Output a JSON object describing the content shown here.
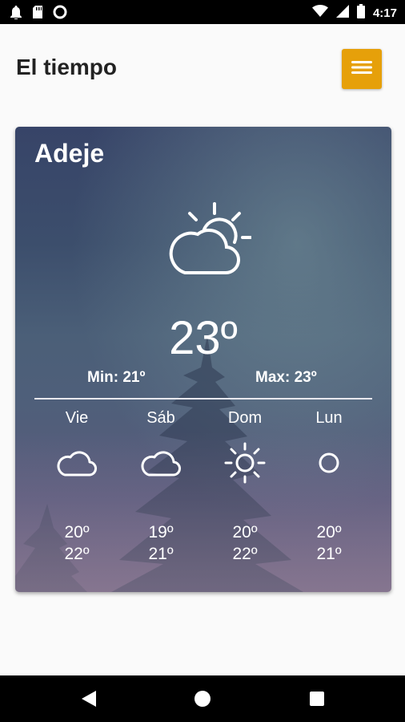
{
  "status_bar": {
    "time": "4:17",
    "icons": [
      "notification-bell-icon",
      "sd-card-icon",
      "circle-o-icon",
      "wifi-icon",
      "signal-icon",
      "battery-icon"
    ]
  },
  "app_bar": {
    "title": "El tiempo",
    "menu_icon": "hamburger-menu-icon",
    "accent": "#e6a00a"
  },
  "weather": {
    "city": "Adeje",
    "current_icon": "partly-sunny-cloud-icon",
    "temperature": "23º",
    "min": "Min: 21º",
    "max": "Max: 23º",
    "forecast": [
      {
        "day": "Vie",
        "icon": "cloud-icon",
        "low": "20º",
        "high": "22º"
      },
      {
        "day": "Sáb",
        "icon": "cloud-icon",
        "low": "19º",
        "high": "21º"
      },
      {
        "day": "Dom",
        "icon": "sun-icon",
        "low": "20º",
        "high": "22º"
      },
      {
        "day": "Lun",
        "icon": "circle-icon",
        "low": "20º",
        "high": "21º"
      }
    ]
  },
  "nav_bar": {
    "icons": [
      "back-icon",
      "home-icon",
      "recents-icon"
    ]
  }
}
